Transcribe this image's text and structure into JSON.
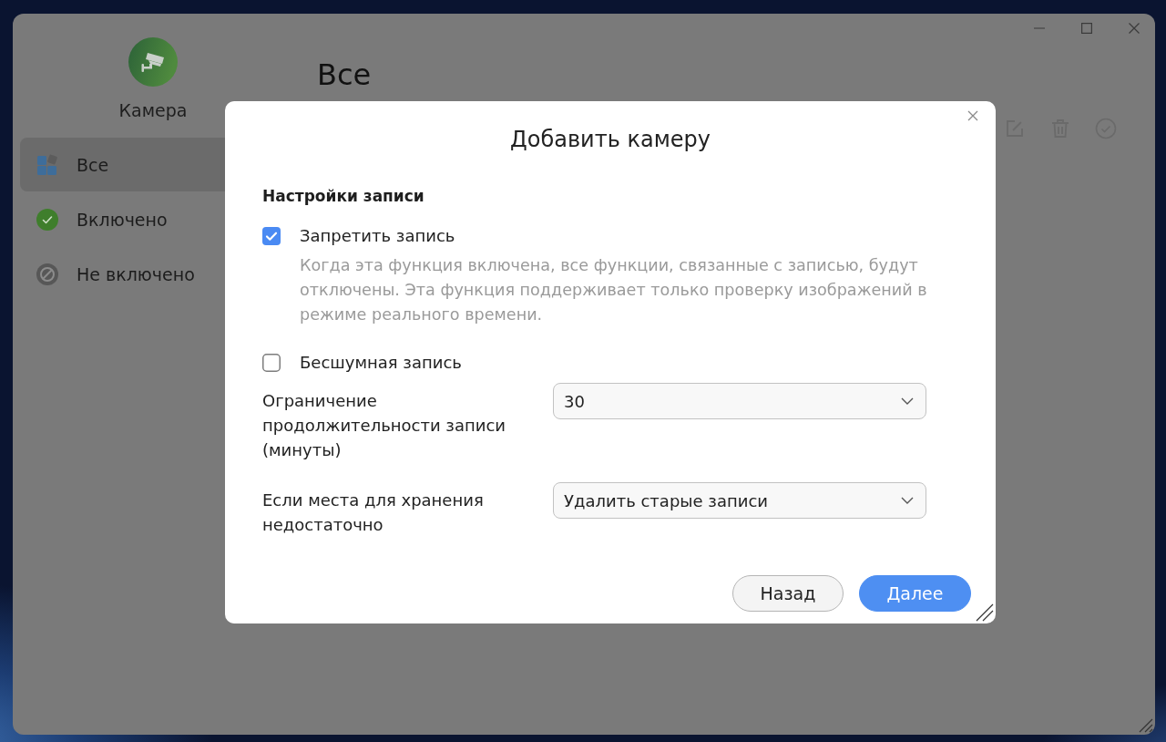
{
  "sidebar": {
    "app_name": "Камера",
    "items": [
      {
        "label": "Все",
        "kind": "all",
        "selected": true
      },
      {
        "label": "Включено",
        "kind": "enabled",
        "selected": false
      },
      {
        "label": "Не включено",
        "kind": "disabled",
        "selected": false
      }
    ]
  },
  "main": {
    "title": "Все"
  },
  "dialog": {
    "title": "Добавить камеру",
    "section": "Настройки записи",
    "options": [
      {
        "label": "Запретить запись",
        "checked": true,
        "description": "Когда эта функция включена, все функции, связанные с записью, будут отключены. Эта функция поддерживает только проверку изображений в режиме реального времени."
      },
      {
        "label": "Бесшумная запись",
        "checked": false
      }
    ],
    "fields": [
      {
        "label": "Ограничение продолжительности записи (минуты)",
        "value": "30"
      },
      {
        "label": "Если места для хранения недостаточно",
        "value": "Удалить старые записи"
      }
    ],
    "buttons": [
      {
        "label": "Назад",
        "kind": "secondary"
      },
      {
        "label": "Далее",
        "kind": "primary"
      }
    ]
  }
}
